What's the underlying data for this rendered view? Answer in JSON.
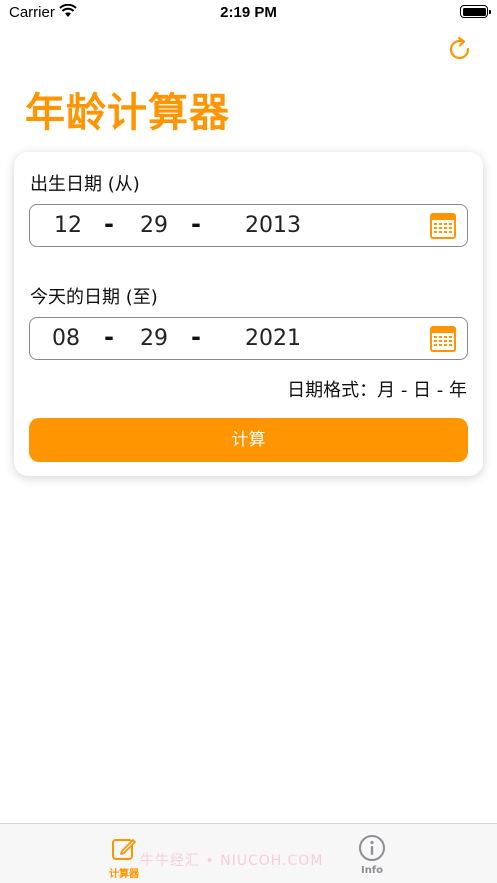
{
  "status_bar": {
    "carrier": "Carrier",
    "time": "2:19 PM"
  },
  "header": {
    "refresh_icon": "refresh-icon",
    "title": "年龄计算器"
  },
  "form": {
    "birth_label": "出生日期 (从)",
    "birth": {
      "month": "12",
      "day": "29",
      "year": "2013"
    },
    "today_label": "今天的日期 (至)",
    "today": {
      "month": "08",
      "day": "29",
      "year": "2021"
    },
    "separator": "-",
    "format_hint": "日期格式：月 - 日 - 年",
    "calculate_label": "计算"
  },
  "tabs": [
    {
      "label": "计算器",
      "icon": "edit-icon",
      "active": true
    },
    {
      "label": "Info",
      "icon": "info-icon",
      "active": false
    }
  ],
  "watermark": "牛牛经汇 • NIUCOH.COM",
  "colors": {
    "accent": "#ff9500",
    "inactive": "#8e8e93"
  }
}
